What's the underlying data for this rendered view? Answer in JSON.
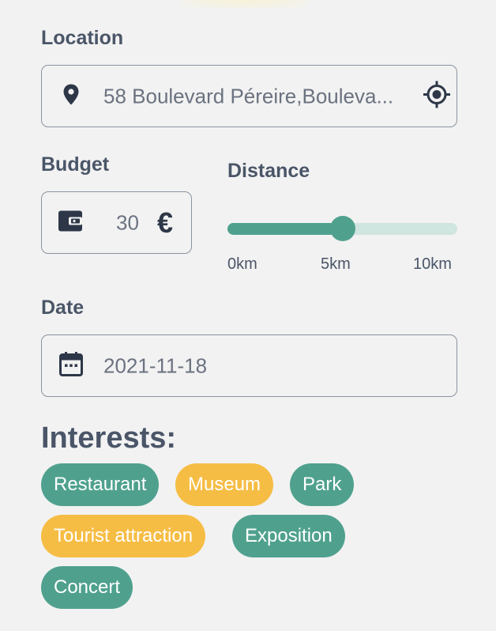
{
  "location": {
    "label": "Location",
    "value": "58 Boulevard Péreire,Bouleva..."
  },
  "budget": {
    "label": "Budget",
    "value": "30",
    "currency_symbol": "€"
  },
  "distance": {
    "label": "Distance",
    "min_label": "0km",
    "mid_label": "5km",
    "max_label": "10km",
    "value_km": 5,
    "max_km": 10
  },
  "date": {
    "label": "Date",
    "value": "2021-11-18"
  },
  "interests": {
    "title": "Interests:",
    "chips": [
      {
        "label": "Restaurant",
        "selected": false
      },
      {
        "label": "Museum",
        "selected": true
      },
      {
        "label": "Park",
        "selected": false
      },
      {
        "label": "Tourist attraction",
        "selected": true
      },
      {
        "label": "Exposition",
        "selected": false
      },
      {
        "label": "Concert",
        "selected": false
      }
    ]
  },
  "colors": {
    "accent_green": "#4fa18e",
    "accent_yellow": "#f6bd45",
    "track_light": "#cfe5df",
    "text_dark": "#4a5568",
    "icon_dark": "#2d3748"
  },
  "icons": {
    "location_field": "map-pin-icon",
    "location_action": "crosshair-target-icon",
    "budget_field": "wallet-icon",
    "date_field": "calendar-icon"
  }
}
